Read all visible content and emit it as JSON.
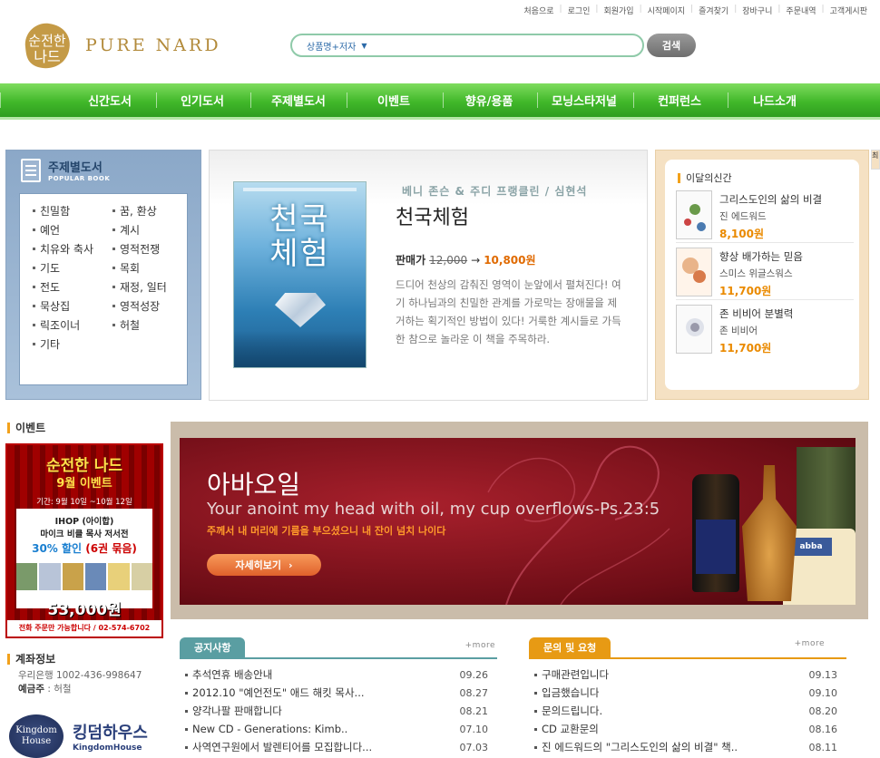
{
  "util_links": [
    "처음으로",
    "로그인",
    "회원가입",
    "시작페이지",
    "즐겨찾기",
    "장바구니",
    "주문내역",
    "고객게시판"
  ],
  "logo": {
    "emblem_text": "순전한 나드",
    "wordmark": "PURE NARD"
  },
  "search": {
    "category": "상품명+저자",
    "value": "",
    "button": "검색"
  },
  "nav": [
    "신간도서",
    "인기도서",
    "주제별도서",
    "이벤트",
    "향유/용품",
    "모닝스타저널",
    "컨퍼런스",
    "나드소개"
  ],
  "topic": {
    "title": "주제별도서",
    "subtitle": "POPULAR BOOK",
    "items": [
      "친밀함",
      "꿈, 환상",
      "예언",
      "계시",
      "치유와 축사",
      "영적전쟁",
      "기도",
      "목회",
      "전도",
      "재정, 일터",
      "묵상집",
      "영적성장",
      "릭조이너",
      "허철",
      "기타"
    ]
  },
  "feature": {
    "authors": "베니 존슨 & 주디 프랭클린 / 심현석",
    "title": "천국체험",
    "cover_title_1": "천국",
    "cover_title_2": "체험",
    "price_label": "판매가",
    "old_price": "12,000",
    "arrow": "→",
    "new_price": "10,800원",
    "description": "드디어 천상의 감춰진 영역이 눈앞에서 펼쳐진다! 여기 하나님과의 친밀한 관계를 가로막는 장애물을 제거하는 획기적인 방법이 있다! 거룩한 계시들로 가득한 참으로 놀라운 이 책을 주목하라."
  },
  "monthly": {
    "title": "이달의신간",
    "items": [
      {
        "title": "그리스도인의 삶의 비결",
        "author": "진 에드워드",
        "price": "8,100원"
      },
      {
        "title": "향상 배가하는 믿음",
        "author": "스미스 위글스워스",
        "price": "11,700원"
      },
      {
        "title": "존 비비어 분별력",
        "author": "존 비비어",
        "price": "11,700원"
      }
    ]
  },
  "edge_tab": "최",
  "event": {
    "section_title": "이벤트",
    "ad": {
      "headline": "순전한 나드",
      "subheadline": "9월 이벤트",
      "period": "기간: 9월 10일 ~10월 12일",
      "line1": "IHOP (아이합)",
      "line2": "마이크 비클 목사 저서전",
      "discount_pct": "30% 할인",
      "discount_note": " (6권 묶음)",
      "price": "53,000원",
      "footer": "전화 주문만 가능합니다 / 02-574-6702"
    }
  },
  "banner": {
    "title": "아바오일",
    "subtitle": "Your anoint my head with oil, my cup overflows-Ps.23:5",
    "korean": "주께서 내 머리에 기름을 부으셨으니 내 잔이 넘치 나이다",
    "cta": "자세히보기",
    "jar_label": "abba"
  },
  "account": {
    "section_title": "계좌정보",
    "bank": "우리은행 1002-436-998647",
    "holder_label": "예금주",
    "holder": " : 허철"
  },
  "kingdom_house": {
    "seal_line1": "Kingdom",
    "seal_line2": "House",
    "name_ko": "킹덤하우스",
    "name_en": "KingdomHouse"
  },
  "notice": {
    "tab": "공지사항",
    "more": "+more",
    "color": "#5a9ea2",
    "rows": [
      {
        "title": "추석연휴 배송안내",
        "date": "09.26"
      },
      {
        "title": "2012.10 \"예언전도\" 애드 해킷 목사...",
        "date": "08.27"
      },
      {
        "title": " 양각나팔 판매합니다",
        "date": "08.21"
      },
      {
        "title": "New CD - Generations: Kimb..",
        "date": "07.10"
      },
      {
        "title": "사역연구원에서 발렌티어를 모집합니다...",
        "date": "07.03"
      }
    ]
  },
  "qna": {
    "tab": "문의 및 요청",
    "more": "+more",
    "color": "#e79a14",
    "rows": [
      {
        "title": "구매관련입니다",
        "date": "09.13"
      },
      {
        "title": "입금했습니다",
        "date": "09.10"
      },
      {
        "title": "문의드립니다.",
        "date": "08.20"
      },
      {
        "title": "CD 교환문의",
        "date": "08.16"
      },
      {
        "title": "진 에드워드의 \"그리스도인의 삶의 비결\" 책..",
        "date": "08.11"
      }
    ]
  }
}
